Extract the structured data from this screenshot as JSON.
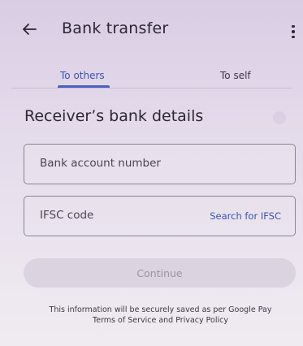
{
  "header": {
    "title": "Bank transfer",
    "back_icon": "arrow-left-icon",
    "menu_icon": "more-vert-icon"
  },
  "tabs": [
    {
      "label": "To others",
      "selected": true
    },
    {
      "label": "To self",
      "selected": false
    }
  ],
  "form": {
    "section_title": "Receiver’s bank details",
    "account_field": {
      "placeholder": "Bank account number",
      "value": ""
    },
    "ifsc_field": {
      "placeholder": "IFSC code",
      "value": "",
      "action_label": "Search for IFSC"
    },
    "continue_label": "Continue",
    "continue_enabled": false
  },
  "footer": {
    "line1": "This information will be securely saved as per Google Pay",
    "line2": "Terms of Service and Privacy Policy"
  },
  "colors": {
    "accent": "#3b52b5",
    "background": "#e3d9ea",
    "disabled_button": "#dbd3df"
  }
}
